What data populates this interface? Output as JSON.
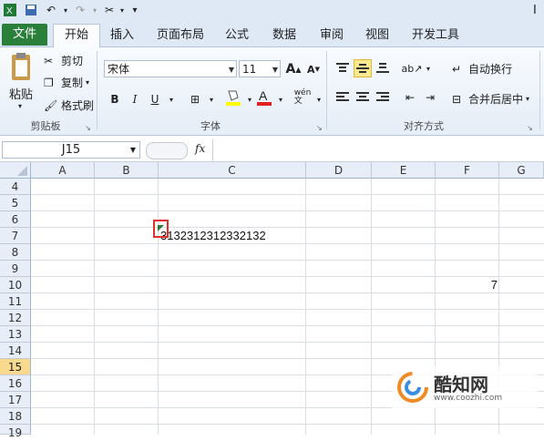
{
  "window": {
    "title_fragment": "I"
  },
  "tabs": [
    "文件",
    "开始",
    "插入",
    "页面布局",
    "公式",
    "数据",
    "审阅",
    "视图",
    "开发工具"
  ],
  "ribbon": {
    "clipboard": {
      "paste": "粘贴",
      "cut": "剪切",
      "copy": "复制",
      "format_painter": "格式刷",
      "label": "剪贴板"
    },
    "font": {
      "font_name": "宋体",
      "font_size": "11",
      "label": "字体",
      "grow_icon": "A",
      "shrink_icon": "A",
      "bold": "B",
      "italic": "I",
      "underline": "U"
    },
    "alignment": {
      "wrap_text": "自动换行",
      "merge_center": "合并后居中",
      "label": "对齐方式"
    }
  },
  "formula_bar": {
    "name_box": "J15",
    "fx": "fx",
    "content": ""
  },
  "grid": {
    "columns": [
      "A",
      "B",
      "C",
      "D",
      "E",
      "F",
      "G"
    ],
    "rows": [
      "4",
      "5",
      "6",
      "7",
      "8",
      "9",
      "10",
      "11",
      "12",
      "13",
      "14",
      "15",
      "16",
      "17",
      "18",
      "19"
    ],
    "selected_row": "15",
    "cells": {
      "C7": "3132312312332132",
      "F10": "7"
    }
  },
  "watermark": {
    "brand": "酷知网",
    "url": "www.coozhi.com"
  },
  "colors": {
    "file_tab": "#2a7f3a",
    "selected_row_header": "#f9d98e",
    "error_marker": "#e03030"
  }
}
